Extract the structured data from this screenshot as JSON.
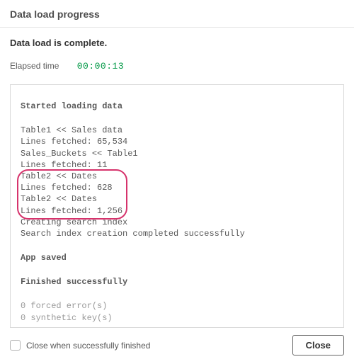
{
  "header": {
    "title": "Data load progress"
  },
  "status": "Data load is complete.",
  "elapsed": {
    "label": "Elapsed time",
    "value": "00:00:13"
  },
  "log": {
    "started_heading": "Started loading data",
    "lines": [
      "Table1 << Sales data",
      "Lines fetched: 65,534",
      "Sales_Buckets << Table1",
      "Lines fetched: 11",
      "Table2 << Dates",
      "Lines fetched: 628",
      "Table2 << Dates",
      "Lines fetched: 1,256",
      "Creating search index",
      "Search index creation completed successfully"
    ],
    "saved_heading": "App saved",
    "finished_heading": "Finished successfully",
    "forced_errors": "0 forced error(s)",
    "synthetic_keys": "0 synthetic key(s)"
  },
  "highlight": {
    "start_index": 4,
    "end_index": 7
  },
  "footer": {
    "checkbox_label": "Close when successfully finished",
    "checkbox_checked": false,
    "close_label": "Close"
  }
}
